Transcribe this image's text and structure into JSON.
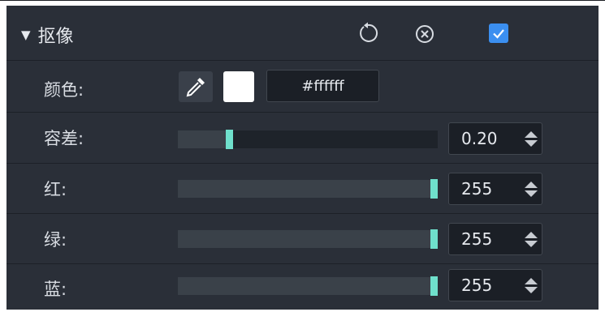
{
  "panel": {
    "title": "抠像",
    "expand_icon": "triangle-down-icon",
    "reset_icon": "reset-icon",
    "close_icon": "circle-close-icon",
    "enabled": true,
    "accent_color": "#3b8ff0"
  },
  "color_row": {
    "label": "颜色:",
    "picker_icon": "eyedropper-icon",
    "swatch_color": "#ffffff",
    "hex_value": "#ffffff"
  },
  "tolerance_row": {
    "label": "容差:",
    "value": "0.20",
    "level": 0.2
  },
  "red_row": {
    "label": "红:",
    "value": "255",
    "level": 1.0
  },
  "green_row": {
    "label": "绿:",
    "value": "255",
    "level": 1.0
  },
  "blue_row": {
    "label": "蓝:",
    "value": "255",
    "level": 1.0
  },
  "slider_thumb_color": "#6fe0cc"
}
